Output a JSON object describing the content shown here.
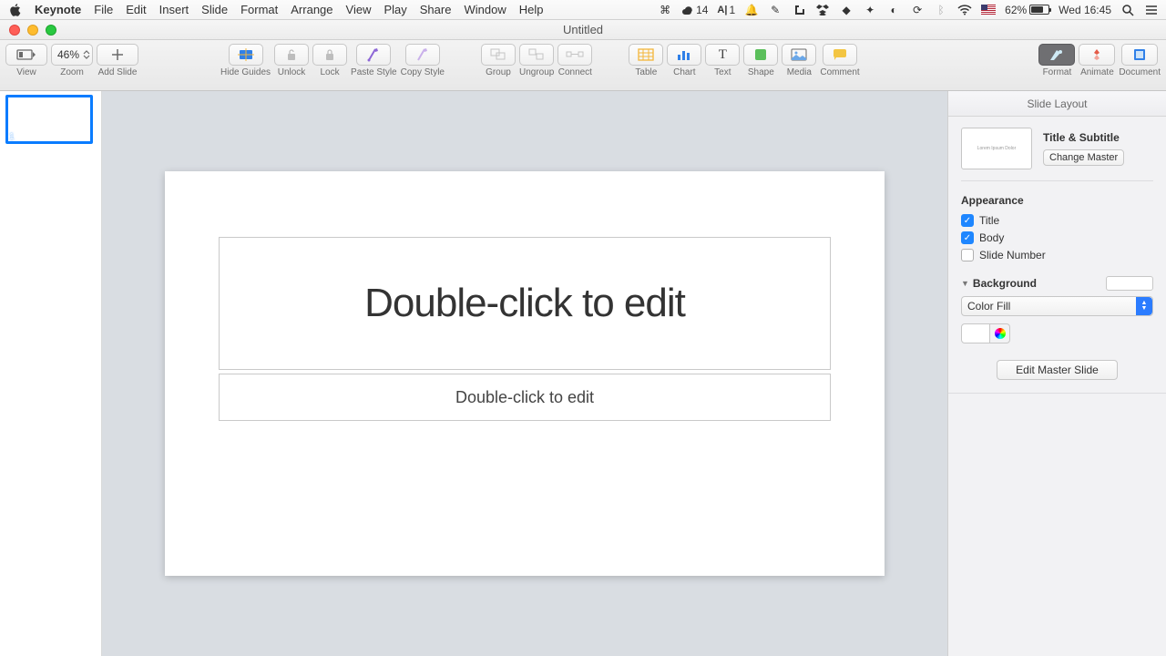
{
  "menubar": {
    "app": "Keynote",
    "items": [
      "File",
      "Edit",
      "Insert",
      "Slide",
      "Format",
      "Arrange",
      "View",
      "Play",
      "Share",
      "Window",
      "Help"
    ],
    "status": {
      "cc_count": "14",
      "ai_count": "1",
      "battery_pct": "62%",
      "clock": "Wed 16:45",
      "flag": "US"
    }
  },
  "window": {
    "title": "Untitled"
  },
  "toolbar": {
    "view": "View",
    "zoom": "Zoom",
    "zoom_value": "46%",
    "add_slide": "Add Slide",
    "hide_guides": "Hide Guides",
    "unlock": "Unlock",
    "lock": "Lock",
    "paste_style": "Paste Style",
    "copy_style": "Copy Style",
    "group": "Group",
    "ungroup": "Ungroup",
    "connect": "Connect",
    "table": "Table",
    "chart": "Chart",
    "text": "Text",
    "shape": "Shape",
    "media": "Media",
    "comment": "Comment",
    "format": "Format",
    "animate": "Animate",
    "document": "Document"
  },
  "slidepanel": {
    "thumb_number": "1"
  },
  "canvas": {
    "title_placeholder": "Double-click to edit",
    "subtitle_placeholder": "Double-click to edit"
  },
  "inspector": {
    "header": "Slide Layout",
    "layout_preview_text": "Lorem Ipsum Dolor",
    "layout_name": "Title & Subtitle",
    "change_master": "Change Master",
    "appearance": "Appearance",
    "title_label": "Title",
    "body_label": "Body",
    "slide_number_label": "Slide Number",
    "checks": {
      "title": true,
      "body": true,
      "slide_number": false
    },
    "background_label": "Background",
    "fill_type": "Color Fill",
    "edit_master": "Edit Master Slide"
  }
}
